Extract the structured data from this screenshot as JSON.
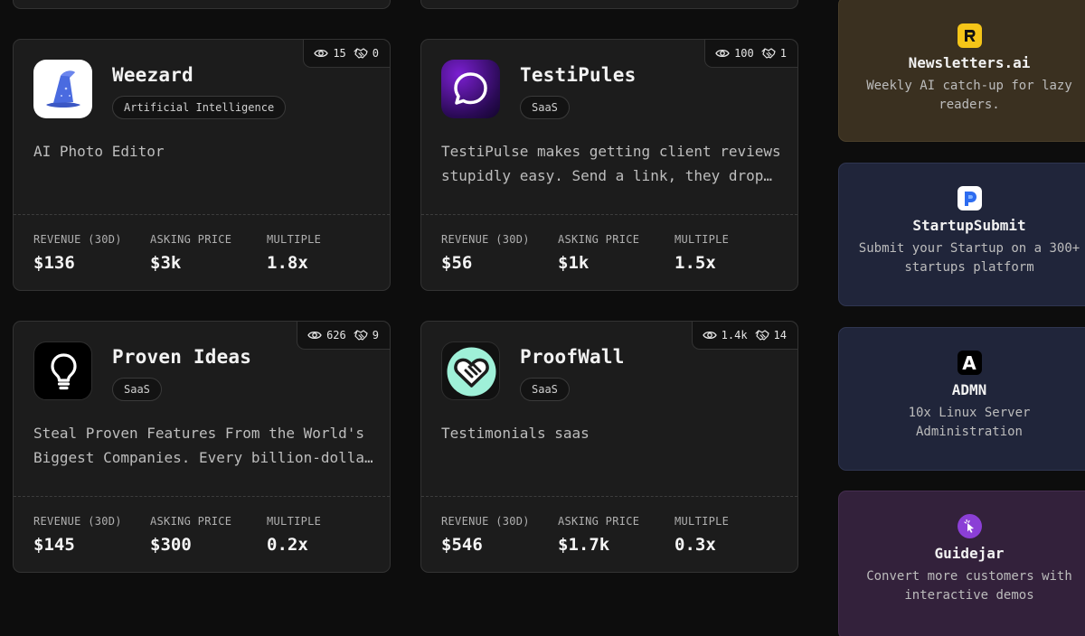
{
  "listings": [
    {
      "name": "Weezard",
      "tag": "Artificial Intelligence",
      "description": "AI Photo Editor",
      "views": "15",
      "saves": "0",
      "metrics": [
        {
          "label": "REVENUE (30D)",
          "value": "$136"
        },
        {
          "label": "ASKING PRICE",
          "value": "$3k"
        },
        {
          "label": "MULTIPLE",
          "value": "1.8x"
        }
      ],
      "logo_icon": "wizard-hat-icon"
    },
    {
      "name": "TestiPules",
      "tag": "SaaS",
      "description": "TestiPulse makes getting client reviews stupidly easy. Send a link, they drop…",
      "views": "100",
      "saves": "1",
      "metrics": [
        {
          "label": "REVENUE (30D)",
          "value": "$56"
        },
        {
          "label": "ASKING PRICE",
          "value": "$1k"
        },
        {
          "label": "MULTIPLE",
          "value": "1.5x"
        }
      ],
      "logo_icon": "chat-bubble-icon"
    },
    {
      "name": "Proven Ideas",
      "tag": "SaaS",
      "description": "Steal Proven Features From the World's Biggest Companies. Every billion-dolla…",
      "views": "626",
      "saves": "9",
      "metrics": [
        {
          "label": "REVENUE (30D)",
          "value": "$145"
        },
        {
          "label": "ASKING PRICE",
          "value": "$300"
        },
        {
          "label": "MULTIPLE",
          "value": "0.2x"
        }
      ],
      "logo_icon": "lightbulb-icon"
    },
    {
      "name": "ProofWall",
      "tag": "SaaS",
      "description": "Testimonials saas",
      "views": "1.4k",
      "saves": "14",
      "metrics": [
        {
          "label": "REVENUE (30D)",
          "value": "$546"
        },
        {
          "label": "ASKING PRICE",
          "value": "$1.7k"
        },
        {
          "label": "MULTIPLE",
          "value": "0.3x"
        }
      ],
      "logo_icon": "heart-shield-icon"
    }
  ],
  "sponsors": [
    {
      "name": "Newsletters.ai",
      "description": "Weekly AI catch-up for lazy readers.",
      "bg": "#3a3020",
      "logo_bg": "#f5c518",
      "icon": "r-logo-icon"
    },
    {
      "name": "StartupSubmit",
      "description": "Submit your Startup on a 300+ startups platform",
      "bg": "#20253a",
      "logo_bg": "#2d6cf0",
      "icon": "p-logo-icon"
    },
    {
      "name": "ADMN",
      "description": "10x Linux Server Administration",
      "bg": "#20253a",
      "logo_bg": "#000000",
      "icon": "a-logo-icon",
      "logo_text": "A"
    },
    {
      "name": "Guidejar",
      "description": "Convert more customers with interactive demos",
      "bg": "#33213b",
      "logo_bg": "#8b3fd6",
      "icon": "cursor-click-icon"
    }
  ],
  "colors": {
    "background": "#0d0d0d",
    "card": "#1c1c1c",
    "border": "#333333"
  }
}
